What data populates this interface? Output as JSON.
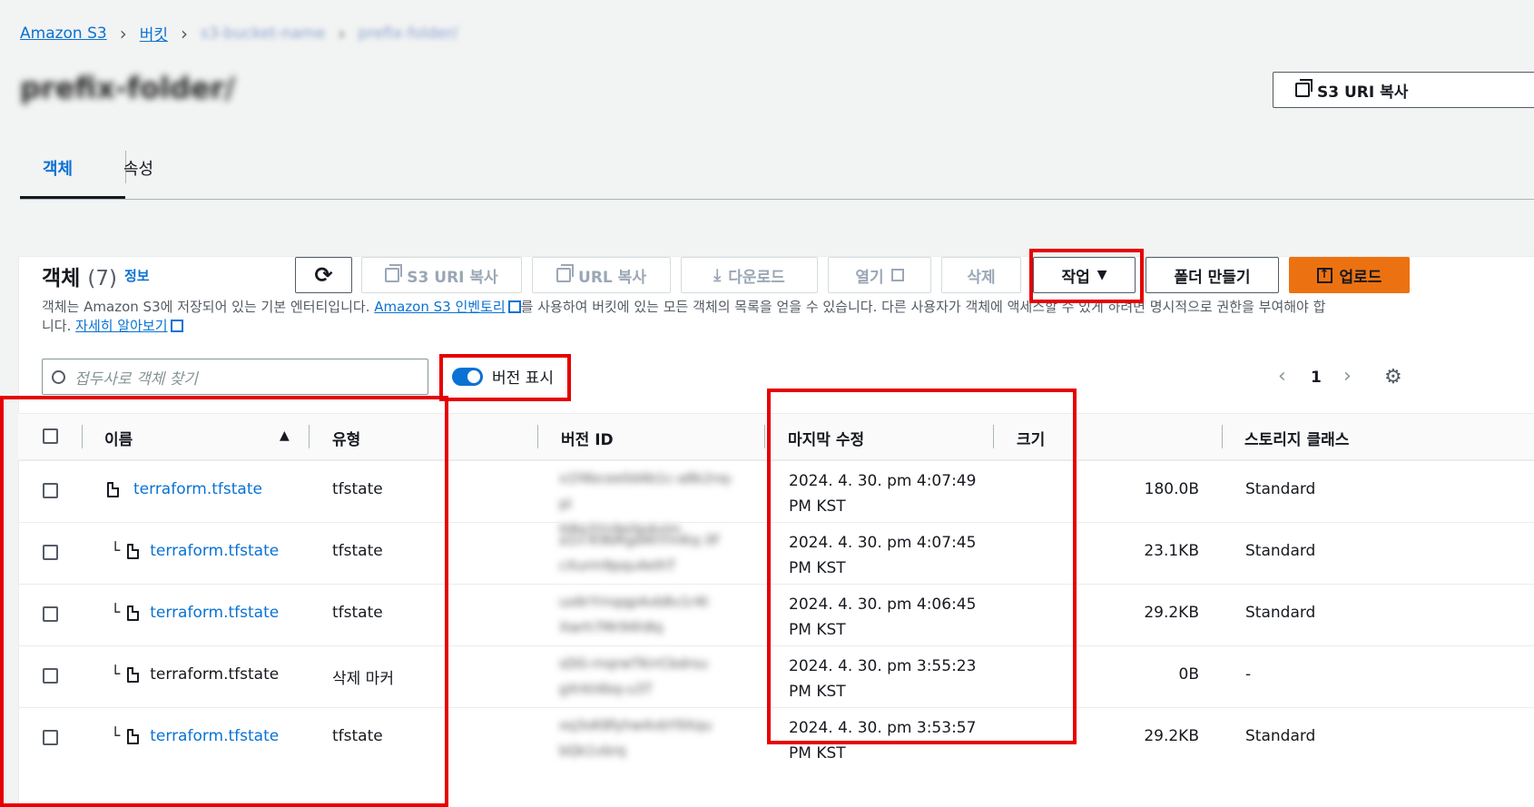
{
  "breadcrumb": {
    "root": "Amazon S3",
    "buckets": "버킷",
    "bucket_name": "s3-bucket-name",
    "folder_name": "prefix-folder/"
  },
  "page": {
    "title": "prefix-folder/",
    "copy_s3_uri": "S3 URI 복사"
  },
  "tabs": [
    {
      "label": "객체",
      "active": true
    },
    {
      "label": "속성",
      "active": false
    }
  ],
  "objects": {
    "heading": "객체",
    "count": "(7)",
    "info": "정보",
    "toolbar": {
      "copy_s3_uri": "S3 URI 복사",
      "copy_url": "URL 복사",
      "download": "다운로드",
      "open": "열기",
      "delete": "삭제",
      "actions": "작업",
      "create_folder": "폴더 만들기",
      "upload": "업로드"
    },
    "description_1": "객체는 Amazon S3에 저장되어 있는 기본 엔터티입니다. ",
    "description_link": "Amazon S3 인벤토리",
    "description_2": "를 사용하여 버킷에 있는 모든 객체의 목록을 얻을 수 있습니다. 다른 사용자가 객체에 액세스할 수 있게 하려면 명시적으로 권한을 부여해야 합",
    "description_3": "니다. ",
    "learn_more": "자세히 알아보기",
    "search_placeholder": "접두사로 객체 찾기",
    "show_versions": "버전 표시",
    "page_number": "1"
  },
  "table": {
    "headers": {
      "name": "이름",
      "type": "유형",
      "version_id": "버전 ID",
      "last_modified": "마지막 수정",
      "size": "크기",
      "storage_class": "스토리지 클래스"
    },
    "rows": [
      {
        "name": "terraform.tfstate",
        "type": "tfstate",
        "version": "x1f4bcee0d4b1c-a8k2nq-pl",
        "version2": "tt8q3Yn9e0p4vlm",
        "date": "2024. 4. 30. pm 4:07:49",
        "tz": "PM KST",
        "size": "180.0B",
        "storage": "Standard",
        "link": true,
        "child": false
      },
      {
        "name": "terraform.tfstate",
        "type": "tfstate",
        "version": "a1n-K9bRgd4hYmKq-3F",
        "version2": "cXurm9pqu4elhT",
        "date": "2024. 4. 30. pm 4:07:45",
        "tz": "PM KST",
        "size": "23.1KB",
        "storage": "Standard",
        "link": true,
        "child": true
      },
      {
        "name": "terraform.tfstate",
        "type": "tfstate",
        "version": "ux6rYrnqqp4vb8v1r4t",
        "version2": "Xwrh7Mr94h8q",
        "date": "2024. 4. 30. pm 4:06:45",
        "tz": "PM KST",
        "size": "29.2KB",
        "storage": "Standard",
        "link": true,
        "child": true
      },
      {
        "name": "terraform.tfstate",
        "type": "삭제 마커",
        "version": "sDG-rnqrwTKrrCbdrsu",
        "version2": "gXrkt4bq-u3T",
        "date": "2024. 4. 30. pm 3:55:23",
        "tz": "PM KST",
        "size": "0B",
        "storage": "-",
        "link": false,
        "child": true
      },
      {
        "name": "terraform.tfstate",
        "type": "tfstate",
        "version": "xq3oK8fyhw4vbY9Xqu",
        "version2": "bQk1vbrq",
        "date": "2024. 4. 30. pm 3:53:57",
        "tz": "PM KST",
        "size": "29.2KB",
        "storage": "Standard",
        "link": true,
        "child": true
      }
    ]
  },
  "colors": {
    "link": "#0972d3",
    "primary": "#ec7211",
    "highlight": "#e60000"
  }
}
